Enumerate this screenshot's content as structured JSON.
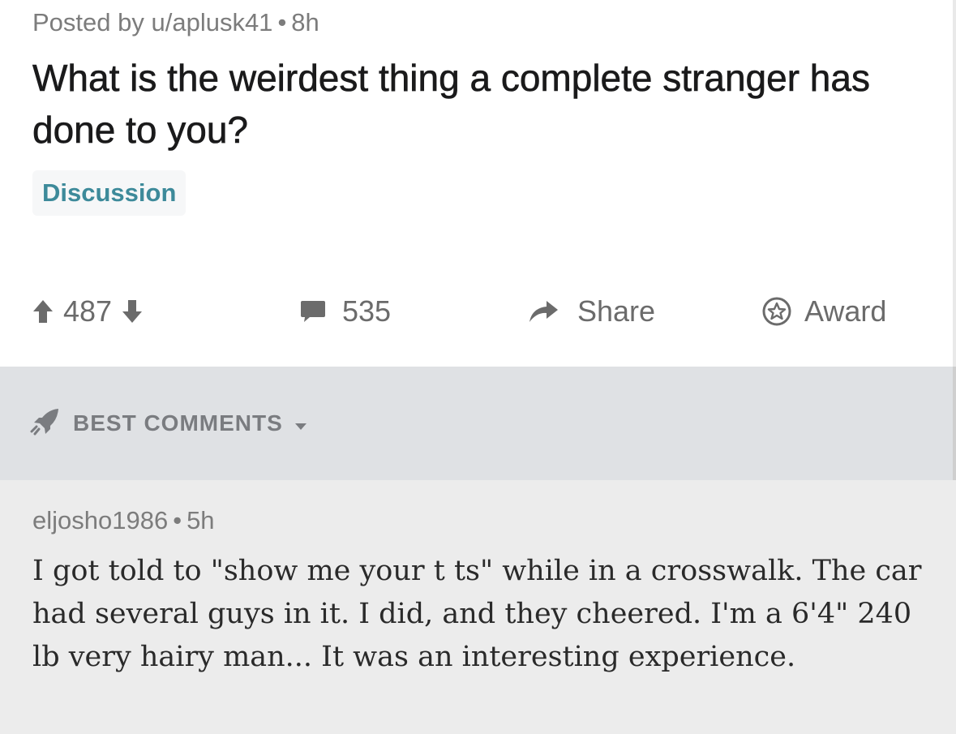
{
  "post": {
    "posted_by": "Posted by u/aplusk41",
    "separator": "•",
    "age": "8h",
    "title": "What is the weirdest thing a complete stranger has done to you?",
    "flair": "Discussion",
    "votes": "487",
    "comment_count": "535",
    "share_label": "Share",
    "award_label": "Award"
  },
  "sort": {
    "label": "BEST COMMENTS"
  },
  "comment": {
    "author": "eljosho1986",
    "separator": "•",
    "age": "5h",
    "body": "I got told to \"show me your t ts\" while in a crosswalk. The car had several guys in it. I did, and they cheered. I'm a 6'4\" 240 lb very hairy man... It was an interesting experience."
  },
  "colors": {
    "meta_text": "#7c7c7c",
    "flair_text": "#3d8a9a",
    "action_text": "#6b6b6b",
    "sortbar_bg": "#dfe1e4",
    "comment_bg": "#ececec"
  },
  "icons": {
    "upvote": "arrow-up-icon",
    "downvote": "arrow-down-icon",
    "comments": "speech-bubble-icon",
    "share": "share-arrow-icon",
    "award": "award-star-icon",
    "sort": "rocket-icon",
    "caret": "caret-down-icon"
  }
}
